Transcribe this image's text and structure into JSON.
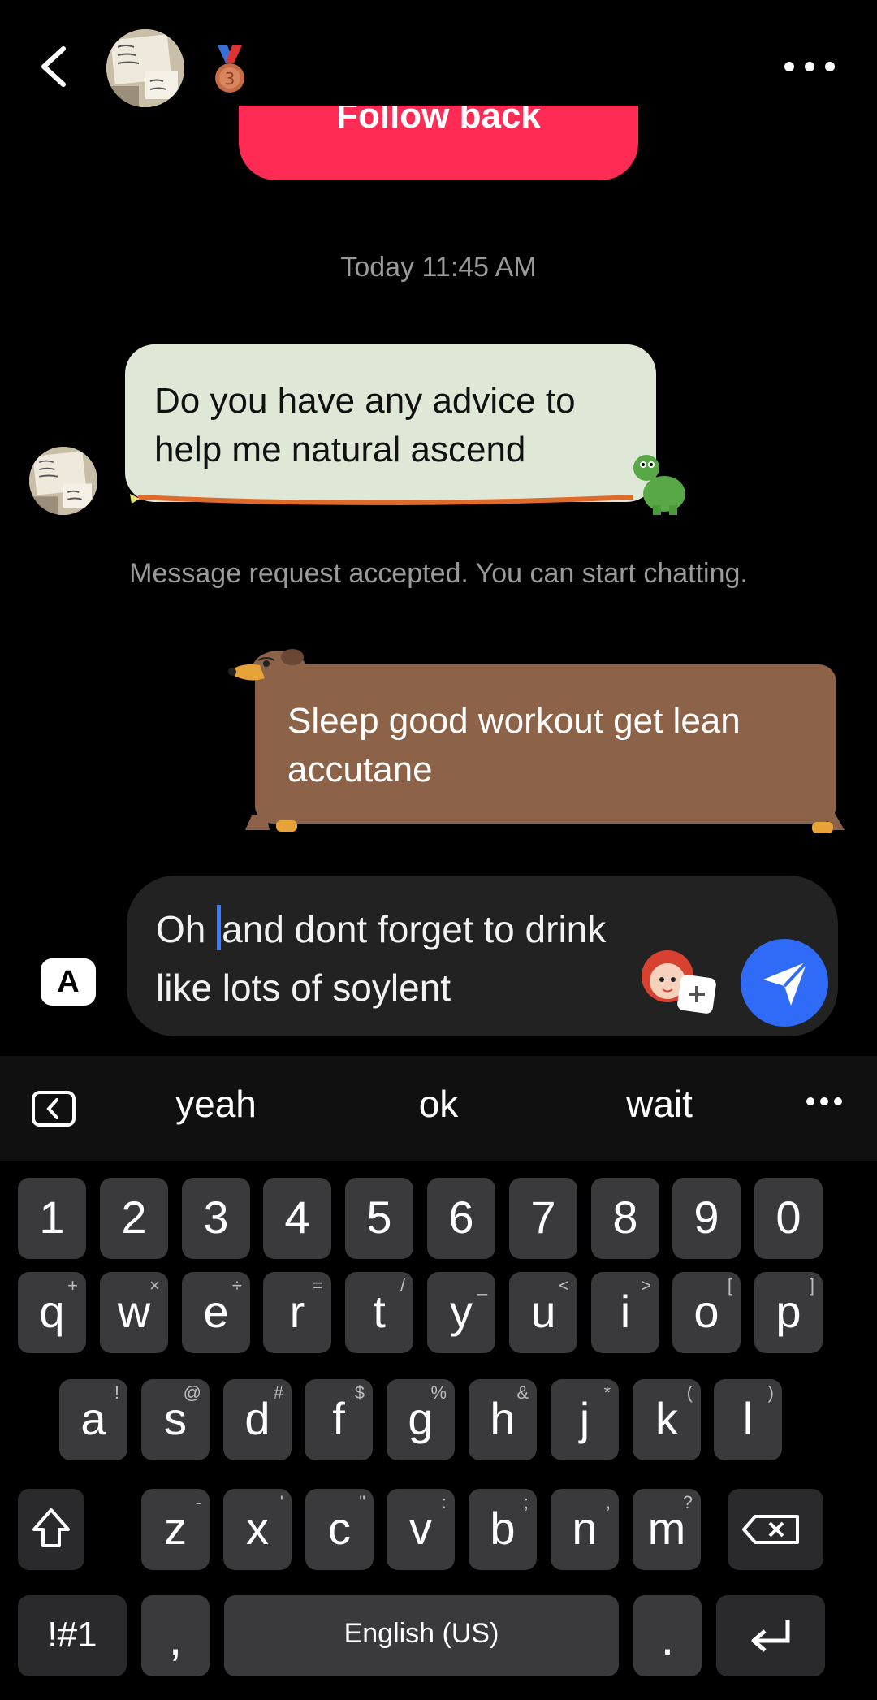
{
  "header": {
    "follow_back_label": "Follow back"
  },
  "chat": {
    "timestamp": "Today 11:45 AM",
    "incoming_message": "Do you have any advice to help me natural ascend",
    "system_message": "Message request accepted. You can start chatting.",
    "outgoing_message": "Sleep good workout get lean accutane"
  },
  "composer": {
    "keyboard_switch_label": "A",
    "text_before_cursor": "Oh ",
    "text_after_cursor": "and dont forget to drink like lots of soylent"
  },
  "keyboard": {
    "suggestions": [
      "yeah",
      "ok",
      "wait"
    ],
    "number_row": [
      "1",
      "2",
      "3",
      "4",
      "5",
      "6",
      "7",
      "8",
      "9",
      "0"
    ],
    "row1": [
      {
        "key": "q",
        "alt": "+"
      },
      {
        "key": "w",
        "alt": "×"
      },
      {
        "key": "e",
        "alt": "÷"
      },
      {
        "key": "r",
        "alt": "="
      },
      {
        "key": "t",
        "alt": "/"
      },
      {
        "key": "y",
        "alt": "_"
      },
      {
        "key": "u",
        "alt": "<"
      },
      {
        "key": "i",
        "alt": ">"
      },
      {
        "key": "o",
        "alt": "["
      },
      {
        "key": "p",
        "alt": "]"
      }
    ],
    "row2": [
      {
        "key": "a",
        "alt": "!"
      },
      {
        "key": "s",
        "alt": "@"
      },
      {
        "key": "d",
        "alt": "#"
      },
      {
        "key": "f",
        "alt": "$"
      },
      {
        "key": "g",
        "alt": "%"
      },
      {
        "key": "h",
        "alt": "&"
      },
      {
        "key": "j",
        "alt": "*"
      },
      {
        "key": "k",
        "alt": "("
      },
      {
        "key": "l",
        "alt": ")"
      }
    ],
    "row3": [
      {
        "key": "z",
        "alt": "-"
      },
      {
        "key": "x",
        "alt": "'"
      },
      {
        "key": "c",
        "alt": "\""
      },
      {
        "key": "v",
        "alt": ":"
      },
      {
        "key": "b",
        "alt": ";"
      },
      {
        "key": "n",
        "alt": ","
      },
      {
        "key": "m",
        "alt": "?"
      }
    ],
    "symbols_label": "!#1",
    "comma_label": ",",
    "space_label": "English (US)",
    "period_label": "."
  },
  "colors": {
    "follow_back": "#fe2c55",
    "incoming_bubble": "#dfe7d6",
    "outgoing_bubble": "#8c6348",
    "send_button": "#2f6bf6",
    "key": "#3a3a3c"
  }
}
